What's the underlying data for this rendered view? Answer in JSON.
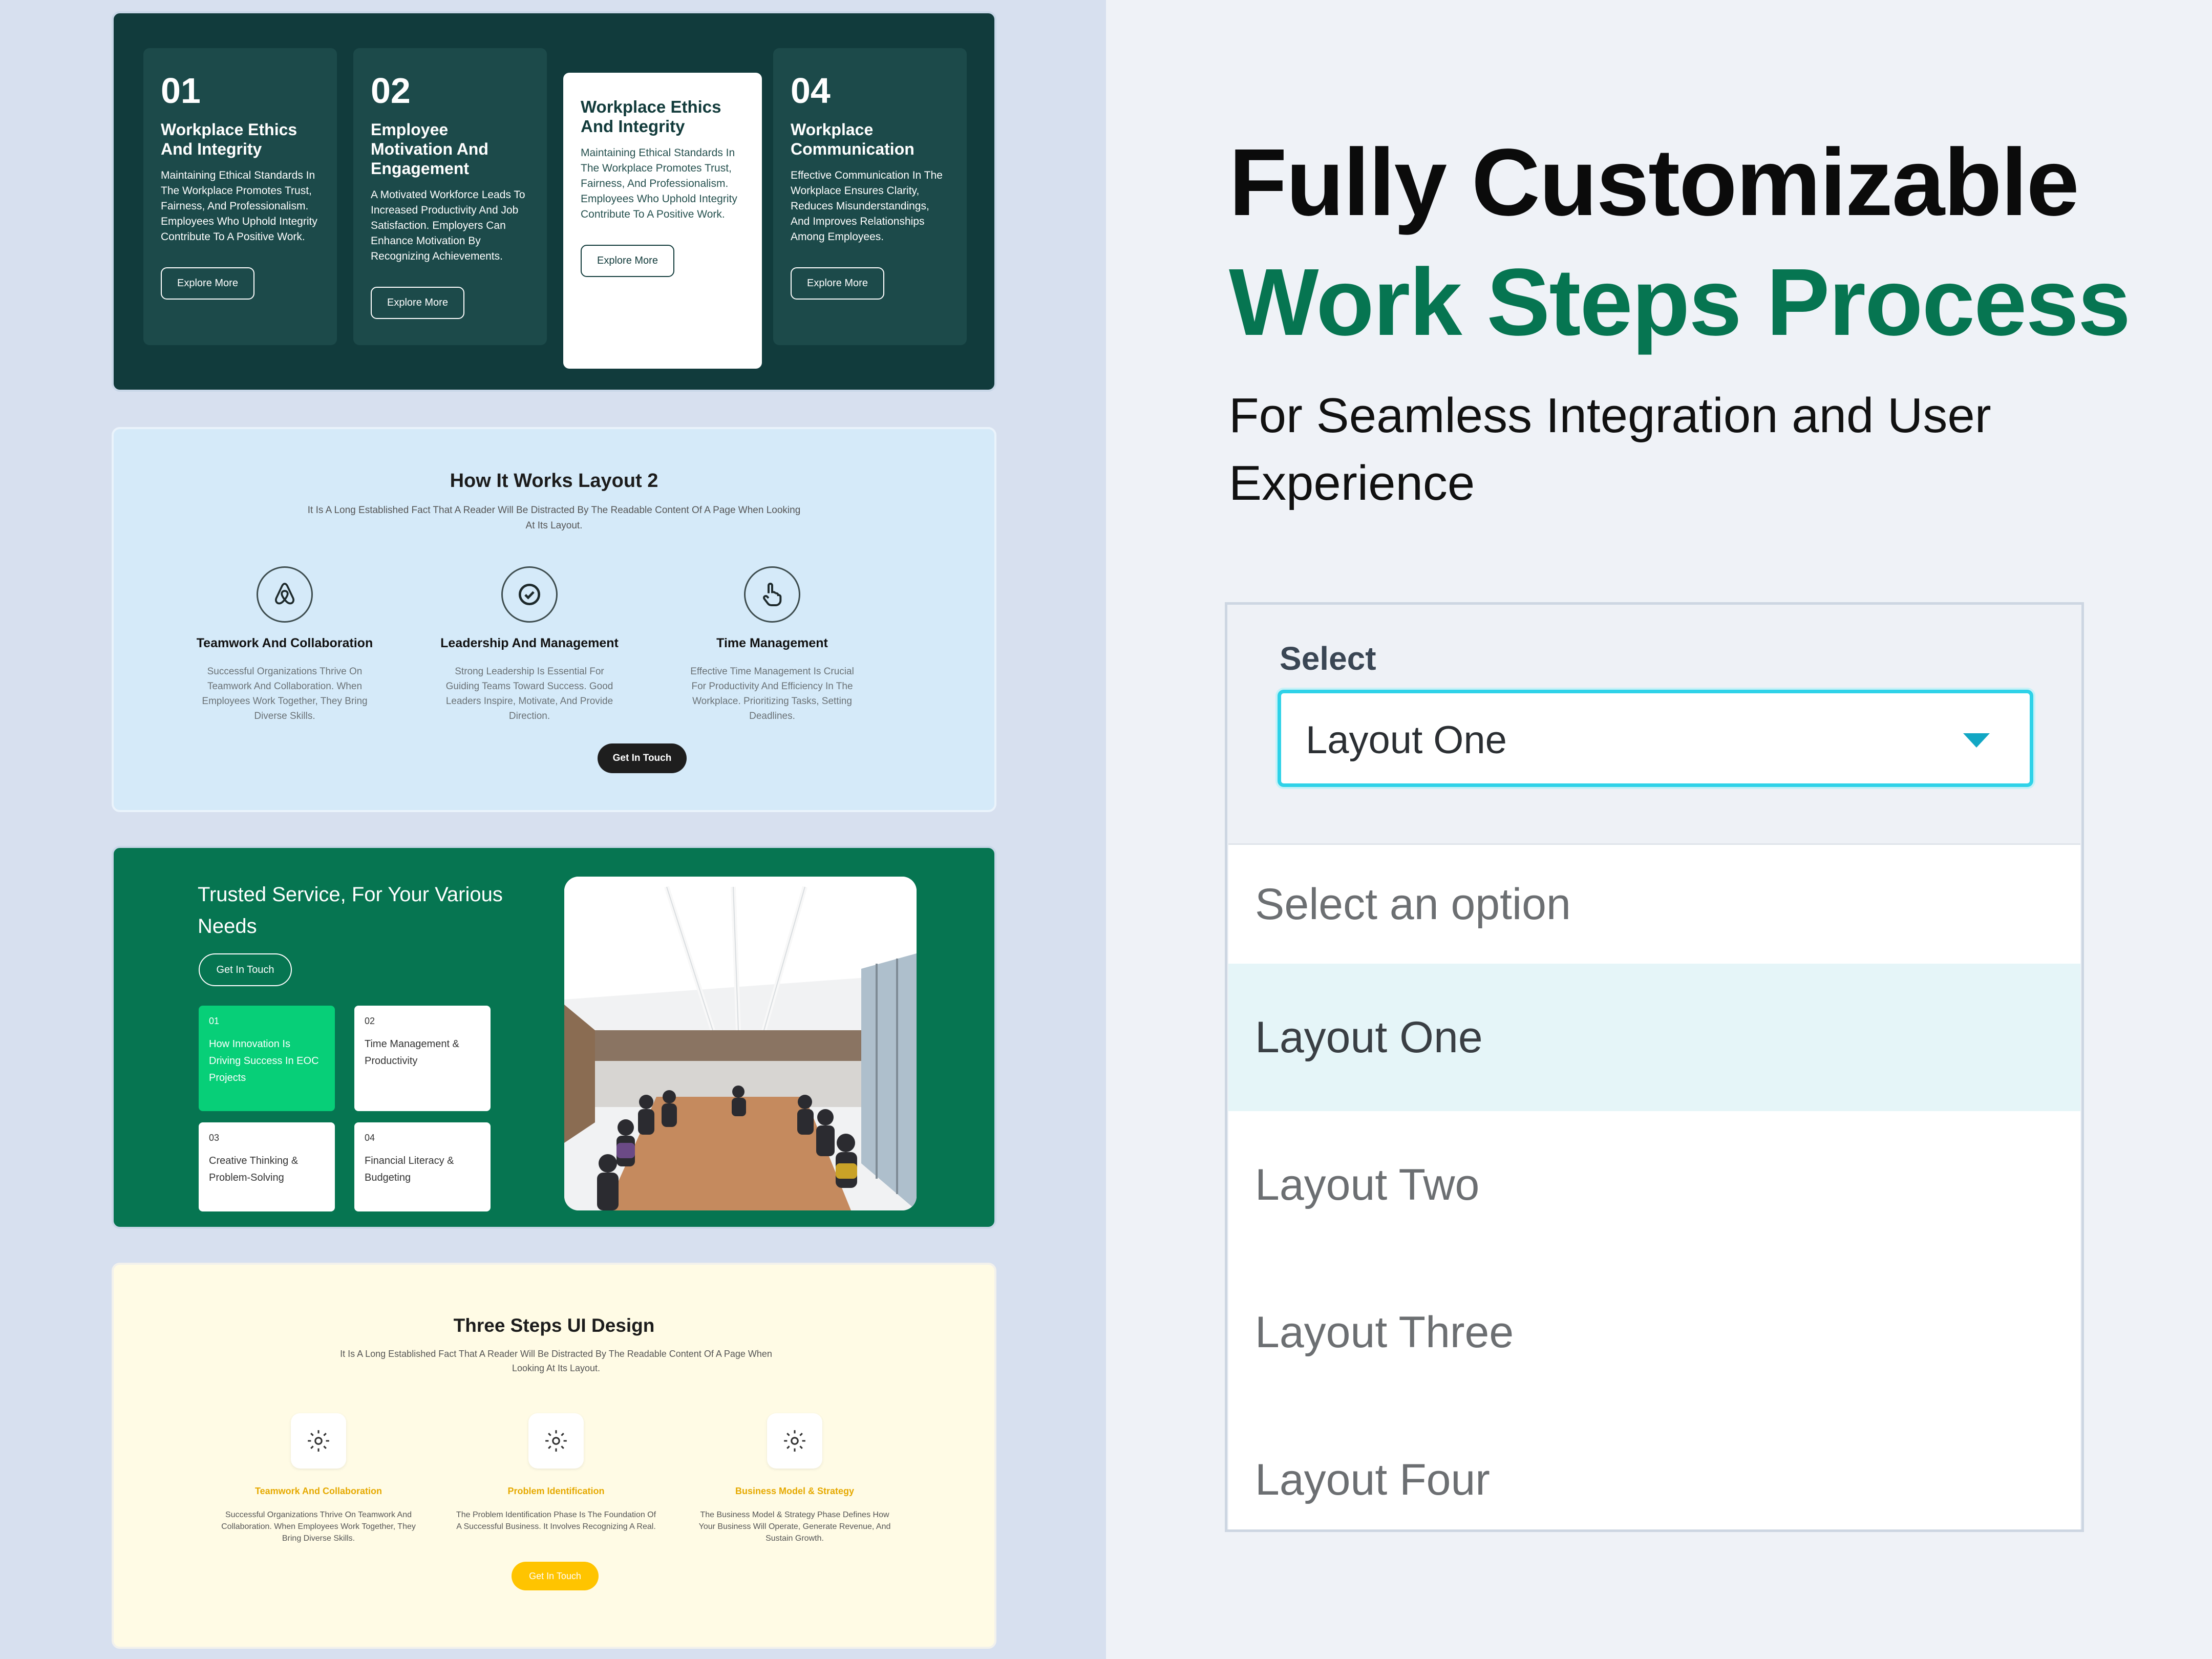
{
  "panel1": {
    "cards": [
      {
        "num": "01",
        "title": "Workplace Ethics\nAnd Integrity",
        "desc": "Maintaining Ethical Standards In The Workplace Promotes Trust, Fairness, And Professionalism. Employees Who Uphold Integrity Contribute To A Positive Work.",
        "button": "Explore More"
      },
      {
        "num": "02",
        "title": "Employee Motivation And Engagement",
        "desc": "A Motivated Workforce Leads To Increased Productivity And Job Satisfaction. Employers Can Enhance Motivation By Recognizing Achievements.",
        "button": "Explore More"
      },
      {
        "num": "",
        "title": "Workplace Ethics And Integrity",
        "desc": "Maintaining Ethical Standards In The Workplace Promotes Trust, Fairness, And Professionalism. Employees Who Uphold Integrity Contribute To A Positive Work.",
        "button": "Explore More"
      },
      {
        "num": "04",
        "title": "Workplace Communication",
        "desc": "Effective Communication In The Workplace Ensures Clarity, Reduces Misunderstandings, And Improves Relationships Among Employees.",
        "button": "Explore More"
      }
    ]
  },
  "panel2": {
    "title": "How It Works Layout 2",
    "subtitle": "It Is A Long Established Fact That A Reader Will Be Distracted By The Readable Content Of A Page When Looking At Its Layout.",
    "columns": [
      {
        "icon": "airbnb-icon",
        "heading": "Teamwork And Collaboration",
        "desc": "Successful Organizations Thrive On Teamwork And Collaboration. When Employees Work Together, They Bring Diverse Skills."
      },
      {
        "icon": "check-circle-icon",
        "heading": "Leadership And Management",
        "desc": "Strong Leadership Is Essential For Guiding Teams Toward Success. Good Leaders Inspire, Motivate, And Provide Direction."
      },
      {
        "icon": "hand-pointer-icon",
        "heading": "Time Management",
        "desc": "Effective Time Management Is Crucial For Productivity And Efficiency In The Workplace. Prioritizing Tasks, Setting Deadlines."
      }
    ],
    "button": "Get In Touch"
  },
  "panel3": {
    "title": "Trusted Service, For Your Various Needs",
    "button": "Get In Touch",
    "tiles": [
      {
        "num": "01",
        "text": "How Innovation Is Driving Success In EOC Projects"
      },
      {
        "num": "02",
        "text": "Time Management & Productivity"
      },
      {
        "num": "03",
        "text": "Creative Thinking & Problem-Solving"
      },
      {
        "num": "04",
        "text": "Financial Literacy & Budgeting"
      }
    ],
    "photo_subject": "conference-room-meeting-photo"
  },
  "panel4": {
    "title": "Three Steps UI Design",
    "subtitle": "It Is A Long Established Fact That A Reader Will Be Distracted By The Readable Content Of A Page When Looking At Its Layout.",
    "columns": [
      {
        "icon": "gear-brain-icon",
        "heading": "Teamwork And Collaboration",
        "desc": "Successful Organizations Thrive On Teamwork And Collaboration. When Employees Work Together, They Bring Diverse Skills."
      },
      {
        "icon": "gear-brain-icon",
        "heading": "Problem Identification",
        "desc": "The Problem Identification Phase Is The Foundation Of A Successful Business. It Involves Recognizing A Real."
      },
      {
        "icon": "gear-brain-icon",
        "heading": "Business Model & Strategy",
        "desc": "The Business Model & Strategy Phase Defines How Your Business Will Operate, Generate Revenue, And Sustain Growth."
      }
    ],
    "button": "Get In Touch"
  },
  "hero": {
    "line1": "Fully Customizable",
    "line2": "Work Steps Process",
    "subtitle": "For Seamless Integration and User Experience"
  },
  "select": {
    "label": "Select",
    "value": "Layout One",
    "options": [
      "Select an option",
      "Layout One",
      "Layout Two",
      "Layout Three",
      "Layout Four"
    ],
    "highlighted_index": 1
  },
  "colors": {
    "dark_teal": "#113b3c",
    "brand_green": "#067551",
    "bright_green": "#07cf78",
    "light_blue": "#d5eaf9",
    "cream": "#fffbe5",
    "yellow": "#ffc400",
    "focus_cyan": "#2fd2e8"
  }
}
